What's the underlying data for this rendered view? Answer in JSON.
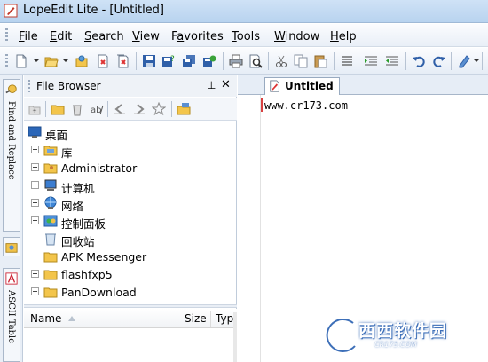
{
  "window": {
    "title": "LopeEdit Lite - [Untitled]"
  },
  "menu": [
    {
      "prefix": "",
      "accel": "F",
      "rest": "ile"
    },
    {
      "prefix": "",
      "accel": "E",
      "rest": "dit"
    },
    {
      "prefix": "",
      "accel": "S",
      "rest": "earch"
    },
    {
      "prefix": "",
      "accel": "V",
      "rest": "iew"
    },
    {
      "prefix": "F",
      "accel": "a",
      "rest": "vorites"
    },
    {
      "prefix": "",
      "accel": "T",
      "rest": "ools"
    },
    {
      "prefix": "",
      "accel": "W",
      "rest": "indow"
    },
    {
      "prefix": "",
      "accel": "H",
      "rest": "elp"
    }
  ],
  "side_tabs": {
    "find_replace": "Find and Replace",
    "ascii_table": "ASCII Table"
  },
  "file_browser": {
    "title": "File Browser",
    "pin_glyph": "⊥",
    "close_glyph": "✕",
    "tree": [
      {
        "label": "桌面",
        "icon": "desktop-icon"
      },
      {
        "label": "库",
        "icon": "library-icon"
      },
      {
        "label": "Administrator",
        "icon": "user-folder-icon"
      },
      {
        "label": "计算机",
        "icon": "computer-icon"
      },
      {
        "label": "网络",
        "icon": "network-icon"
      },
      {
        "label": "控制面板",
        "icon": "control-panel-icon"
      },
      {
        "label": "回收站",
        "icon": "recycle-bin-icon"
      },
      {
        "label": "APK Messenger",
        "icon": "folder-icon"
      },
      {
        "label": "flashfxp5",
        "icon": "folder-icon"
      },
      {
        "label": "PanDownload",
        "icon": "folder-icon"
      }
    ],
    "columns": {
      "name": "Name",
      "size": "Size",
      "type": "Typ"
    }
  },
  "editor": {
    "tab_label": "Untitled",
    "lines": [
      "www.cr173.com"
    ]
  },
  "watermark": {
    "text": "西西软件园",
    "sub": "CR173.COM"
  },
  "colors": {
    "titlebar": "#b8d3ef",
    "accent": "#3d6fb8",
    "caret": "#d94141"
  }
}
